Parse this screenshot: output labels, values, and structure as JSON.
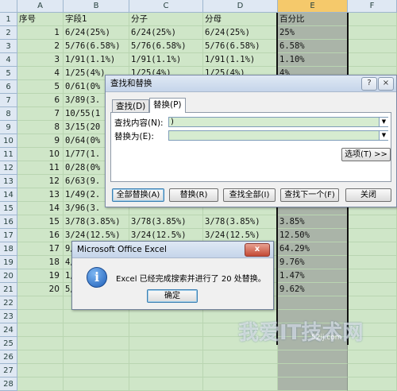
{
  "columns": [
    "A",
    "B",
    "C",
    "D",
    "E",
    "F"
  ],
  "rows": [
    {
      "n": "1",
      "a": "序号",
      "b": "字段1",
      "c": "分子",
      "d": "分母",
      "e": "百分比"
    },
    {
      "n": "2",
      "a": "1",
      "b": "6/24(25%)",
      "c": "6/24(25%)",
      "d": "6/24(25%)",
      "e": "25%"
    },
    {
      "n": "3",
      "a": "2",
      "b": "5/76(6.58%)",
      "c": "5/76(6.58%)",
      "d": "5/76(6.58%)",
      "e": "6.58%"
    },
    {
      "n": "4",
      "a": "3",
      "b": "1/91(1.1%)",
      "c": "1/91(1.1%)",
      "d": "1/91(1.1%)",
      "e": "1.10%"
    },
    {
      "n": "5",
      "a": "4",
      "b": "1/25(4%)",
      "c": "1/25(4%)",
      "d": "1/25(4%)",
      "e": "4%"
    },
    {
      "n": "6",
      "a": "5",
      "b": "0/61(0%",
      "c": "",
      "d": "",
      "e": ""
    },
    {
      "n": "7",
      "a": "6",
      "b": "3/89(3.",
      "c": "",
      "d": "",
      "e": ""
    },
    {
      "n": "8",
      "a": "7",
      "b": "10/55(1",
      "c": "",
      "d": "",
      "e": ""
    },
    {
      "n": "9",
      "a": "8",
      "b": "3/15(20",
      "c": "",
      "d": "",
      "e": ""
    },
    {
      "n": "10",
      "a": "9",
      "b": "0/64(0%",
      "c": "",
      "d": "",
      "e": ""
    },
    {
      "n": "11",
      "a": "10",
      "b": "1/77(1.",
      "c": "",
      "d": "",
      "e": ""
    },
    {
      "n": "12",
      "a": "11",
      "b": "0/28(0%",
      "c": "",
      "d": "",
      "e": ""
    },
    {
      "n": "13",
      "a": "12",
      "b": "6/63(9.",
      "c": "",
      "d": "",
      "e": ""
    },
    {
      "n": "14",
      "a": "13",
      "b": "1/49(2.",
      "c": "",
      "d": "",
      "e": ""
    },
    {
      "n": "15",
      "a": "14",
      "b": "3/96(3.",
      "c": "",
      "d": "",
      "e": ""
    },
    {
      "n": "16",
      "a": "15",
      "b": "3/78(3.85%)",
      "c": "3/78(3.85%)",
      "d": "3/78(3.85%)",
      "e": "3.85%"
    },
    {
      "n": "17",
      "a": "16",
      "b": "3/24(12.5%)",
      "c": "3/24(12.5%)",
      "d": "3/24(12.5%)",
      "e": "12.50%"
    },
    {
      "n": "18",
      "a": "17",
      "b": "9/14(64.29%)",
      "c": "9/14(64.29%)",
      "d": "9/14(64.29%)",
      "e": "64.29%"
    },
    {
      "n": "19",
      "a": "18",
      "b": "4/41(9.76%)",
      "c": "4/41(9.76%)",
      "d": "4/41(9.76%)",
      "e": "9.76%"
    },
    {
      "n": "20",
      "a": "19",
      "b": "1/68(1",
      "c": "",
      "d": "",
      "e": "1.47%"
    },
    {
      "n": "21",
      "a": "20",
      "b": "5/52(9",
      "c": "",
      "d": "",
      "e": "9.62%"
    },
    {
      "n": "22",
      "a": "",
      "b": "",
      "c": "",
      "d": "",
      "e": ""
    },
    {
      "n": "23",
      "a": "",
      "b": "",
      "c": "",
      "d": "",
      "e": ""
    },
    {
      "n": "24",
      "a": "",
      "b": "",
      "c": "",
      "d": "",
      "e": ""
    },
    {
      "n": "25",
      "a": "",
      "b": "",
      "c": "",
      "d": "",
      "e": ""
    },
    {
      "n": "26",
      "a": "",
      "b": "",
      "c": "",
      "d": "",
      "e": ""
    },
    {
      "n": "27",
      "a": "",
      "b": "",
      "c": "",
      "d": "",
      "e": ""
    },
    {
      "n": "28",
      "a": "",
      "b": "",
      "c": "",
      "d": "",
      "e": ""
    }
  ],
  "find_replace": {
    "title": "查找和替换",
    "help": "?",
    "close": "×",
    "tab_find": "查找(D)",
    "tab_replace": "替换(P)",
    "find_label": "查找内容(N):",
    "find_value": ")",
    "replace_label": "替换为(E):",
    "replace_value": "",
    "options_button": "选项(T) >>",
    "replace_all": "全部替换(A)",
    "replace": "替换(R)",
    "find_all": "查找全部(I)",
    "find_next": "查找下一个(F)",
    "close_button": "关闭"
  },
  "message_box": {
    "title": "Microsoft Office Excel",
    "message": "Excel 已经完成搜索并进行了 20 处替换。",
    "ok": "确定",
    "close": "x"
  },
  "watermark": {
    "main": "我爱IT技术网",
    "sub": "52ij.com"
  },
  "colors": {
    "sheet_bg": "#cfe6c8",
    "selected_col_bg": "#aab4a8",
    "header_highlight": "#f5c96b"
  }
}
